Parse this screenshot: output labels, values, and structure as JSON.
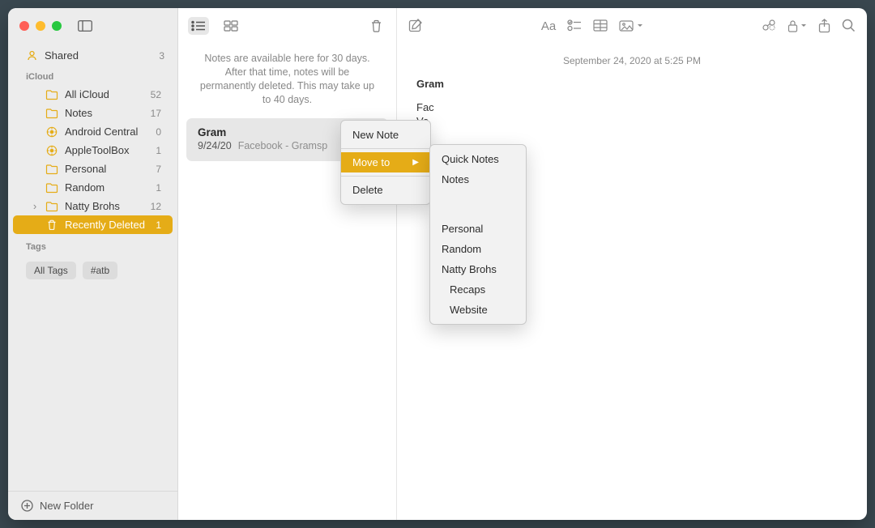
{
  "sidebar": {
    "shared": {
      "label": "Shared",
      "count": "3"
    },
    "account_header": "iCloud",
    "folders": [
      {
        "label": "All iCloud",
        "count": "52",
        "icon": "folder"
      },
      {
        "label": "Notes",
        "count": "17",
        "icon": "folder"
      },
      {
        "label": "Android Central",
        "count": "0",
        "icon": "smart"
      },
      {
        "label": "AppleToolBox",
        "count": "1",
        "icon": "smart"
      },
      {
        "label": "Personal",
        "count": "7",
        "icon": "folder"
      },
      {
        "label": "Random",
        "count": "1",
        "icon": "folder"
      },
      {
        "label": "Natty Brohs",
        "count": "12",
        "icon": "folder",
        "expandable": true
      },
      {
        "label": "Recently Deleted",
        "count": "1",
        "icon": "trash",
        "selected": true
      }
    ],
    "tags_header": "Tags",
    "tags": [
      "All Tags",
      "#atb"
    ],
    "new_folder": "New Folder"
  },
  "list": {
    "notice": "Notes are available here for 30 days. After that time, notes will be permanently deleted. This may take up to 40 days.",
    "note": {
      "title": "Gram",
      "date": "9/24/20",
      "preview": "Facebook - Gramsp"
    }
  },
  "editor": {
    "date": "September 24, 2020 at 5:25 PM",
    "title": "Gram",
    "lines": [
      "Fac",
      "Ve"
    ]
  },
  "context1": {
    "items": [
      "New Note",
      "Move to",
      "Delete"
    ],
    "highlighted": "Move to"
  },
  "context2": {
    "groups": [
      [
        "Quick Notes",
        "Notes"
      ],
      [
        "Personal",
        "Random",
        "Natty Brohs"
      ],
      [
        "Recaps",
        "Website"
      ]
    ]
  }
}
